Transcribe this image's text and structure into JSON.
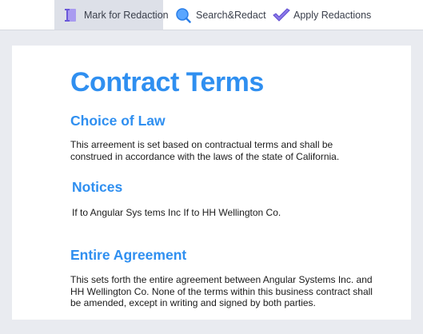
{
  "toolbar": {
    "mark_label": "Mark for Redaction",
    "search_label": "Search&Redact",
    "apply_label": "Apply Redactions",
    "colors": {
      "icon_purple": "#7b6ae0",
      "icon_blue": "#3d8df5",
      "active_bg": "#dde0e8"
    }
  },
  "document": {
    "title": "Contract Terms",
    "sections": [
      {
        "heading": "Choice of Law",
        "lines": [
          "This arreement is set based on contractual terms and shall be",
          "construed in accordance with the laws of the state of California."
        ]
      },
      {
        "heading": "Notices",
        "lines": [
          "If to Angular Sys tems Inc If to HH Wellington Co."
        ]
      },
      {
        "heading": "Entire Agreement",
        "lines": [
          "This sets forth the entire agreement between Angular Systems Inc. and",
          "HH Wellington Co. None of the terms within this business contract shall",
          "be amended, except in writing and signed by both parties."
        ]
      }
    ],
    "colors": {
      "heading": "#2f8ff0",
      "text": "#1b1b1b"
    }
  }
}
